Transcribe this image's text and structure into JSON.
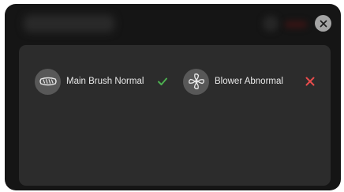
{
  "close": {
    "icon": "close-icon"
  },
  "components": [
    {
      "label": "Main Brush Normal",
      "icon": "main-brush-icon",
      "status": "ok",
      "status_icon": "checkmark-icon",
      "status_color": "#4caf50"
    },
    {
      "label": "Blower Abnormal",
      "icon": "fan-icon",
      "status": "fail",
      "status_icon": "cross-icon",
      "status_color": "#e84c4c"
    }
  ]
}
